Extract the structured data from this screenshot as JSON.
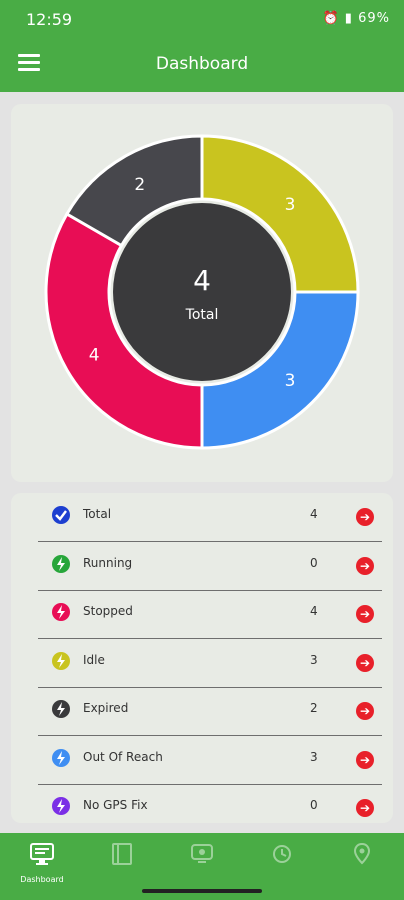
{
  "status_bar": {
    "time": "12:59",
    "battery": "69%"
  },
  "header": {
    "title": "Dashboard"
  },
  "chart_data": {
    "type": "pie",
    "center_value": "4",
    "center_label": "Total",
    "segments": [
      {
        "value": 3,
        "label": "3",
        "color": "#c9c41f"
      },
      {
        "value": 3,
        "label": "3",
        "color": "#3f8ef2"
      },
      {
        "value": 4,
        "label": "4",
        "color": "#e80d55"
      },
      {
        "value": 2,
        "label": "2",
        "color": "#47474c"
      }
    ],
    "center_color": "#3a3a3c"
  },
  "status_list": [
    {
      "label": "Total",
      "count": "4",
      "icon": "check-circle-icon",
      "color": "#1d3fd0"
    },
    {
      "label": "Running",
      "count": "0",
      "icon": "bolt-icon",
      "color": "#27a63a"
    },
    {
      "label": "Stopped",
      "count": "4",
      "icon": "bolt-icon",
      "color": "#e80d55"
    },
    {
      "label": "Idle",
      "count": "3",
      "icon": "bolt-icon",
      "color": "#c9c41f"
    },
    {
      "label": "Expired",
      "count": "2",
      "icon": "bolt-icon",
      "color": "#3a3a3c"
    },
    {
      "label": "Out Of Reach",
      "count": "3",
      "icon": "bolt-icon",
      "color": "#3f8ef2"
    },
    {
      "label": "No GPS Fix",
      "count": "0",
      "icon": "bolt-icon",
      "color": "#7b2fe6"
    }
  ],
  "bottom_nav": {
    "active_label": "Dashboard"
  }
}
